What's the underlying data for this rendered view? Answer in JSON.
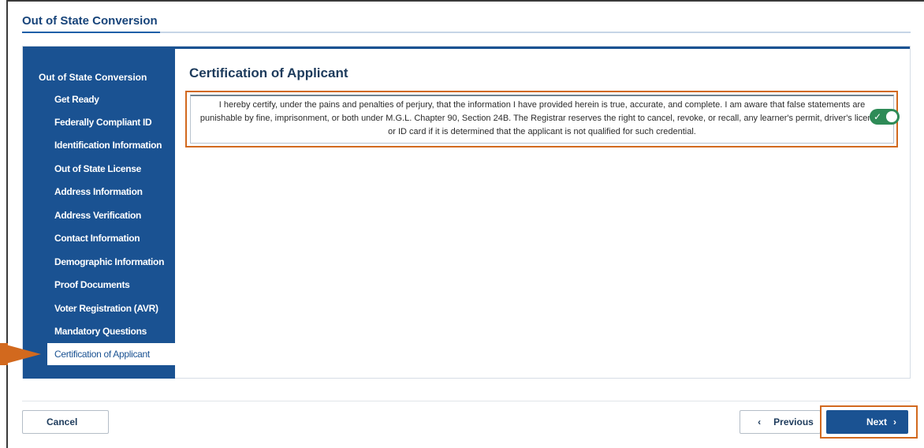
{
  "page": {
    "title": "Out of State Conversion"
  },
  "sidebar": {
    "heading": "Out of State Conversion",
    "items": [
      {
        "label": "Get Ready"
      },
      {
        "label": "Federally Compliant ID"
      },
      {
        "label": "Identification Information"
      },
      {
        "label": "Out of State License"
      },
      {
        "label": "Address Information"
      },
      {
        "label": "Address Verification"
      },
      {
        "label": "Contact Information"
      },
      {
        "label": "Demographic Information"
      },
      {
        "label": "Proof Documents"
      },
      {
        "label": "Voter Registration (AVR)"
      },
      {
        "label": "Mandatory Questions"
      },
      {
        "label": "Certification of Applicant"
      }
    ],
    "active_index": 11
  },
  "main": {
    "title": "Certification of Applicant",
    "certification_text": "I hereby certify, under the pains and penalties of perjury, that the information I have provided herein is true, accurate, and complete. I am aware that false statements are punishable by fine, imprisonment, or both under M.G.L. Chapter 90, Section 24B. The Registrar reserves the right to cancel, revoke, or recall, any learner's permit, driver's license, or ID card if it is determined that the applicant is not qualified for such credential.",
    "certify_toggle": {
      "on": true,
      "icon": "check-icon"
    }
  },
  "footer": {
    "cancel_label": "Cancel",
    "previous_label": "Previous",
    "previous_icon": "chevron-left-icon",
    "next_label": "Next",
    "next_icon": "chevron-right-icon"
  },
  "colors": {
    "primary": "#1a5292",
    "highlight": "#d2691e",
    "toggle_on": "#2e8b57"
  }
}
